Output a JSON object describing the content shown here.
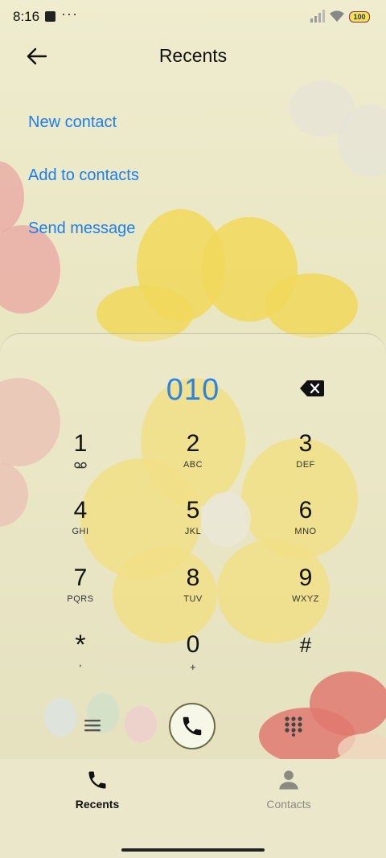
{
  "status_bar": {
    "time": "8:16",
    "overflow": "···",
    "battery": "100"
  },
  "header": {
    "title": "Recents",
    "back_icon": "arrow-left-icon"
  },
  "actions": [
    {
      "label": "New contact"
    },
    {
      "label": "Add to contacts"
    },
    {
      "label": "Send message"
    }
  ],
  "dialer": {
    "number": "010",
    "keys": [
      {
        "digit": "1",
        "letters": ""
      },
      {
        "digit": "2",
        "letters": "ABC"
      },
      {
        "digit": "3",
        "letters": "DEF"
      },
      {
        "digit": "4",
        "letters": "GHI"
      },
      {
        "digit": "5",
        "letters": "JKL"
      },
      {
        "digit": "6",
        "letters": "MNO"
      },
      {
        "digit": "7",
        "letters": "PQRS"
      },
      {
        "digit": "8",
        "letters": "TUV"
      },
      {
        "digit": "9",
        "letters": "WXYZ"
      },
      {
        "digit": "*",
        "letters": ","
      },
      {
        "digit": "0",
        "letters": "+"
      },
      {
        "digit": "#",
        "letters": ""
      }
    ]
  },
  "bottom_nav": {
    "items": [
      {
        "label": "Recents",
        "active": true
      },
      {
        "label": "Contacts",
        "active": false
      }
    ]
  },
  "colors": {
    "accent": "#1a7ff2",
    "dial_number": "#2a83e6",
    "inactive_nav": "#8a8a80"
  }
}
